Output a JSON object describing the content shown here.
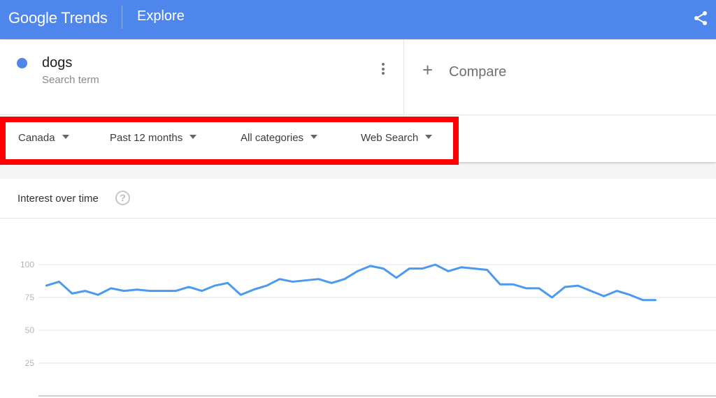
{
  "header": {
    "brand": "Google Trends",
    "page": "Explore",
    "brand_color": "#4f86ec",
    "share_icon": "share-icon"
  },
  "search_term": {
    "name": "dogs",
    "type": "Search term",
    "color": "#4f86ec"
  },
  "compare": {
    "icon": "plus-icon",
    "label": "Compare"
  },
  "filters": [
    {
      "label": "Canada"
    },
    {
      "label": "Past 12 months"
    },
    {
      "label": "All categories"
    },
    {
      "label": "Web Search"
    }
  ],
  "highlight_color": "#ff0000",
  "card": {
    "title": "Interest over time",
    "help_icon": "?"
  },
  "chart_data": {
    "type": "line",
    "title": "Interest over time",
    "xlabel": "",
    "ylabel": "",
    "ylim": [
      0,
      100
    ],
    "yticks": [
      25,
      50,
      75,
      100
    ],
    "grid": true,
    "series": [
      {
        "name": "dogs",
        "color": "#4a9af0",
        "values": [
          84,
          87,
          78,
          80,
          77,
          82,
          80,
          81,
          80,
          80,
          80,
          83,
          80,
          84,
          86,
          77,
          81,
          84,
          89,
          87,
          88,
          89,
          86,
          89,
          95,
          99,
          97,
          90,
          97,
          97,
          100,
          95,
          98,
          97,
          96,
          85,
          85,
          82,
          82,
          75,
          83,
          84,
          80,
          76,
          80,
          77,
          73,
          73
        ]
      }
    ]
  }
}
